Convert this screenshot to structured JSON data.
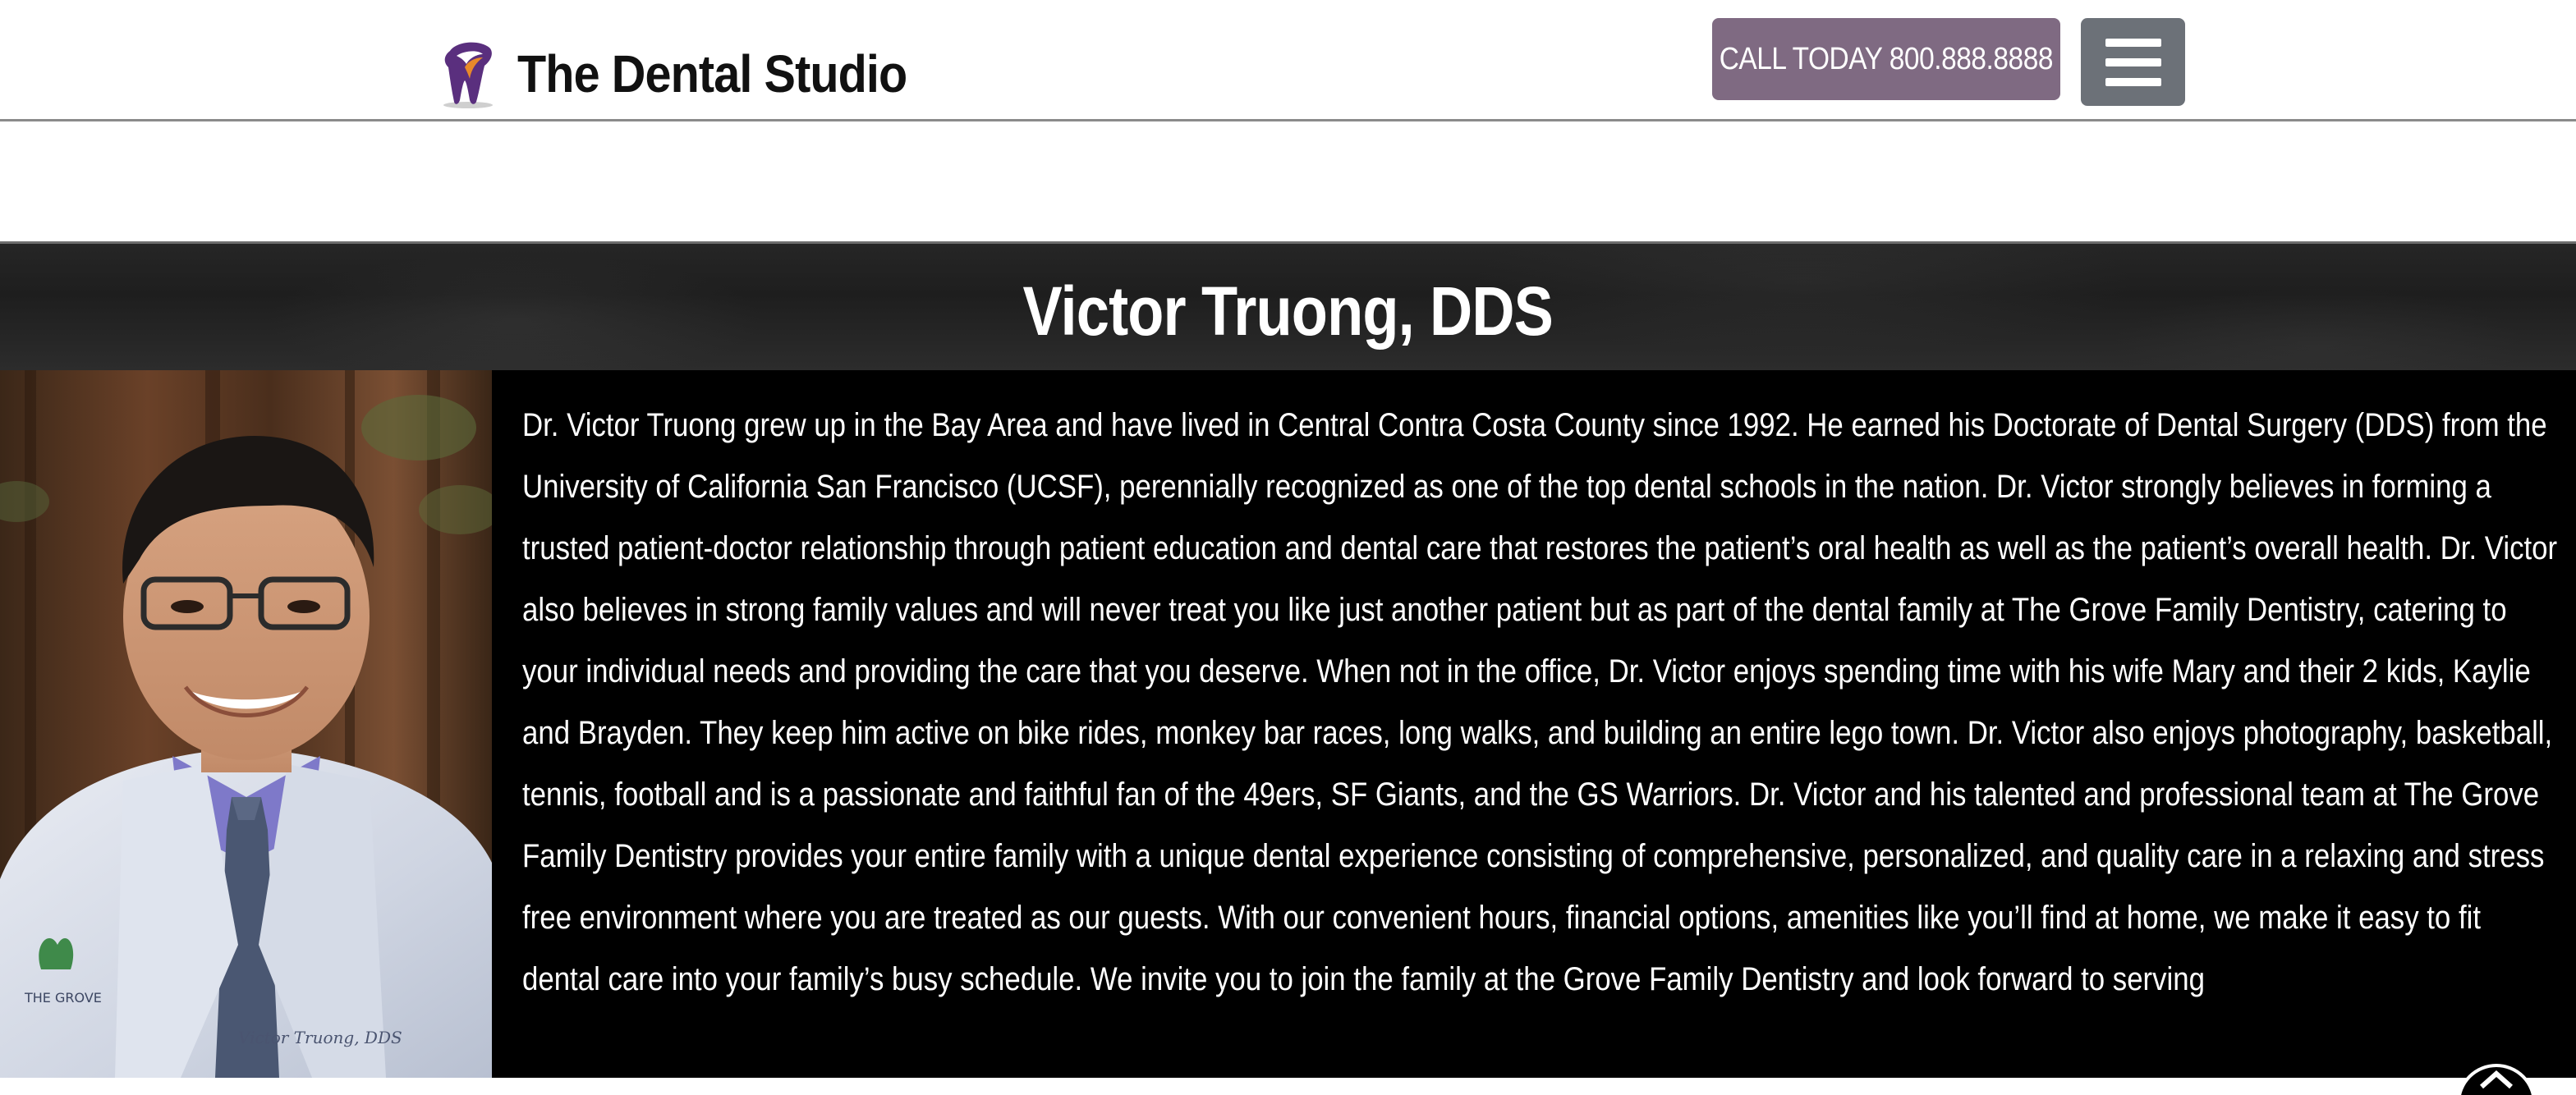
{
  "header": {
    "brand": "The Dental Studio",
    "call_label": "CALL TODAY 800.888.8888",
    "menu_icon": "hamburger-menu-icon"
  },
  "hero": {
    "title": "Victor Truong, DDS"
  },
  "portrait": {
    "coat_caption": "Victor Truong, DDS",
    "badge": "THE GROVE"
  },
  "bio": {
    "text": "Dr. Victor Truong grew up in the Bay Area and have lived in Central Contra Costa County since 1992. He earned his Doctorate of Dental Surgery (DDS) from the University of California San Francisco (UCSF), perennially recognized as one of the top dental schools in the nation. Dr. Victor strongly believes in forming a trusted patient-doctor relationship through patient education and dental care that restores the patient’s oral health as well as the patient’s overall health. Dr. Victor also believes in strong family values and will never treat you like just another patient but as part of the dental family at The Grove Family Dentistry, catering to your individual needs and providing the care that you deserve. When not in the office, Dr. Victor enjoys spending time with his wife Mary and their 2 kids, Kaylie and Brayden. They keep him active on bike rides, monkey bar races, long walks, and building an entire lego town. Dr. Victor also enjoys photography, basketball, tennis, football and is a passionate and faithful fan of the 49ers, SF Giants, and the GS Warriors. Dr. Victor and his talented and professional team at The Grove Family Dentistry provides your entire family with a unique dental experience consisting of comprehensive, personalized, and quality care in a relaxing and stress free environment where you are treated as our guests. With our convenient hours, financial options, amenities like you’ll find at home, we make it easy to fit dental care into your family’s busy schedule. We invite you to join the family at the Grove Family Dentistry and look forward to serving"
  },
  "colors": {
    "call_button": "#7f6a82",
    "menu_button": "#6c7178",
    "content_bg": "#000000",
    "logo_purple": "#6b3d8a",
    "logo_orange": "#e8892a"
  }
}
